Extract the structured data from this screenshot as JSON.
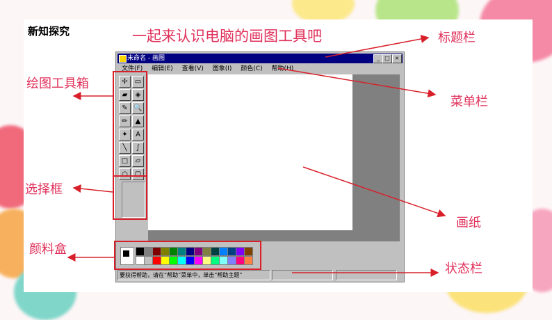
{
  "heading": "新知探究",
  "slide_title": "一起来认识电脑的画图工具吧",
  "labels": {
    "titlebar": "标题栏",
    "toolbox": "绘图工具箱",
    "menubar": "菜单栏",
    "selection": "选择框",
    "paper": "画纸",
    "palette": "颜料盒",
    "statusbar": "状态栏"
  },
  "window": {
    "title": "未命名 - 画图",
    "min": "_",
    "max": "□",
    "close": "×",
    "menu": [
      "文件(F)",
      "编辑(E)",
      "查看(V)",
      "图象(I)",
      "颜色(C)",
      "帮助(H)"
    ],
    "status_text": "要获得帮助，请在“帮助”菜单中，单击“帮助主题”"
  },
  "tools": [
    "free-select",
    "rect-select",
    "eraser",
    "fill",
    "picker",
    "magnifier",
    "pencil",
    "brush",
    "airbrush",
    "text",
    "line",
    "curve",
    "rectangle",
    "polygon",
    "ellipse",
    "rounded-rect"
  ],
  "tool_glyphs": [
    "✢",
    "▭",
    "▰",
    "◈",
    "✎",
    "🔍",
    "✏",
    "▲",
    "✦",
    "A",
    "╲",
    "∫",
    "□",
    "▱",
    "○",
    "▢"
  ],
  "palette_colors": [
    "#000000",
    "#808080",
    "#800000",
    "#808000",
    "#008000",
    "#008080",
    "#000080",
    "#800080",
    "#808040",
    "#004040",
    "#0080ff",
    "#004080",
    "#8000ff",
    "#804000",
    "#ffffff",
    "#c0c0c0",
    "#ff0000",
    "#ffff00",
    "#00ff00",
    "#00ffff",
    "#0000ff",
    "#ff00ff",
    "#ffff80",
    "#00ff80",
    "#80ffff",
    "#8080ff",
    "#ff0080",
    "#ff8040"
  ],
  "accent": "#e0305a",
  "highlight": "#d8202a"
}
